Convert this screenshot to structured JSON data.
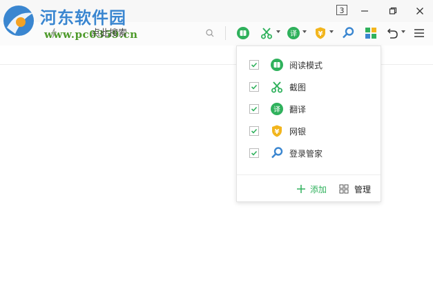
{
  "watermark": {
    "brand": "河东软件园",
    "site": "www.pc0359.cn"
  },
  "titlebar": {
    "tab_count": "3"
  },
  "search": {
    "placeholder": "点此搜索"
  },
  "panel": {
    "items": [
      {
        "label": "阅读模式",
        "icon": "reading-mode-icon",
        "checked": true
      },
      {
        "label": "截图",
        "icon": "scissors-icon",
        "checked": true
      },
      {
        "label": "翻译",
        "icon": "translate-icon",
        "checked": true
      },
      {
        "label": "网银",
        "icon": "bank-shield-icon",
        "checked": true
      },
      {
        "label": "登录管家",
        "icon": "login-key-icon",
        "checked": true
      }
    ],
    "add_label": "添加",
    "manage_label": "管理",
    "translate_glyph": "译",
    "bank_glyph": "¥"
  },
  "colors": {
    "green": "#2fb15c",
    "gold": "#f2b51d",
    "blue": "#3a86d0"
  }
}
